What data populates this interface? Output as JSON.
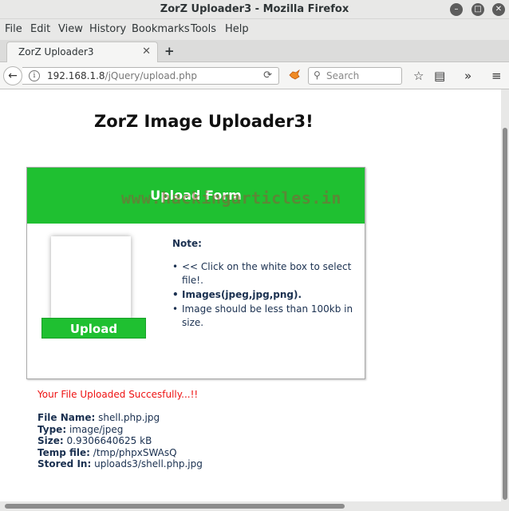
{
  "window": {
    "title": "ZorZ Uploader3 - Mozilla Firefox"
  },
  "menu": {
    "items": [
      "File",
      "Edit",
      "View",
      "History",
      "Bookmarks",
      "Tools",
      "Help"
    ]
  },
  "tabs": [
    {
      "label": "ZorZ Uploader3"
    }
  ],
  "navbar": {
    "url_host": "192.168.1.8",
    "url_path": "/jQuery/upload.php",
    "search_placeholder": "Search"
  },
  "page": {
    "heading": "ZorZ Image Uploader3!",
    "form_title": "Upload Form",
    "watermark": "www.hackingarticles.in",
    "upload_button": "Upload",
    "note_title": "Note:",
    "notes": [
      "<< Click on the white box to select file!.",
      "Images(jpeg,jpg,png).",
      "Image should be less than 100kb in size."
    ],
    "success_message": "Your File Uploaded Succesfully...!!",
    "file_info": [
      {
        "key": "File Name:",
        "value": "shell.php.jpg"
      },
      {
        "key": "Type:",
        "value": "image/jpeg"
      },
      {
        "key": "Size:",
        "value": "0.9306640625 kB"
      },
      {
        "key": "Temp file:",
        "value": "/tmp/phpxSWAsQ"
      },
      {
        "key": "Stored In:",
        "value": "uploads3/shell.php.jpg"
      }
    ]
  },
  "colors": {
    "accent_green": "#1fc031",
    "success_red": "#ee1111",
    "text_navy": "#1a3050"
  }
}
